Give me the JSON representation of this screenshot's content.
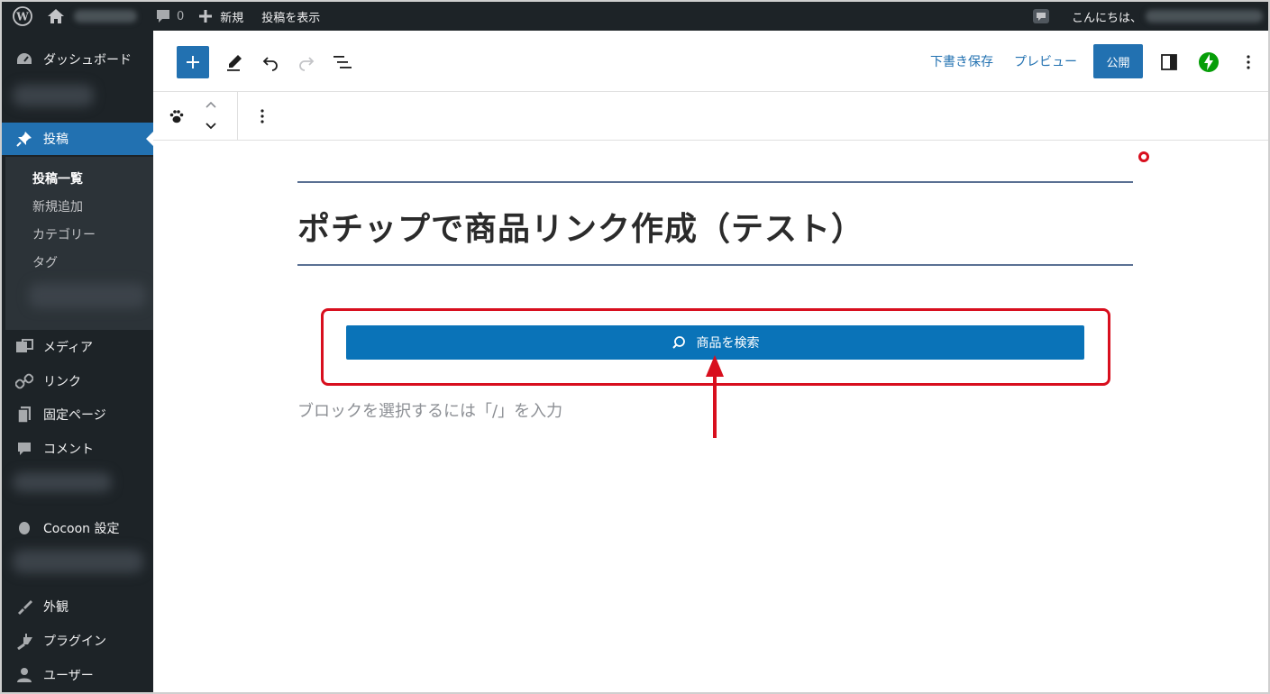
{
  "admin_bar": {
    "comments_count": "0",
    "new_label": "新規",
    "view_post_label": "投稿を表示",
    "greeting": "こんにちは、"
  },
  "sidebar": {
    "dashboard": "ダッシュボード",
    "posts": "投稿",
    "submenu": [
      "投稿一覧",
      "新規追加",
      "カテゴリー",
      "タグ"
    ],
    "media": "メディア",
    "links": "リンク",
    "pages": "固定ページ",
    "comments": "コメント",
    "cocoon": "Cocoon 設定",
    "appearance": "外観",
    "plugins": "プラグイン",
    "users": "ユーザー"
  },
  "header": {
    "save_draft": "下書き保存",
    "preview": "プレビュー",
    "publish": "公開"
  },
  "editor": {
    "post_title": "ポチップで商品リンク作成（テスト）",
    "search_button": "商品を検索",
    "placeholder": "ブロックを選択するには「/」を入力"
  },
  "colors": {
    "admin_bg": "#1d2327",
    "accent": "#2271b1",
    "highlight": "#d80f1e",
    "title_rule": "#5a7093",
    "jetpack": "#069e08"
  }
}
